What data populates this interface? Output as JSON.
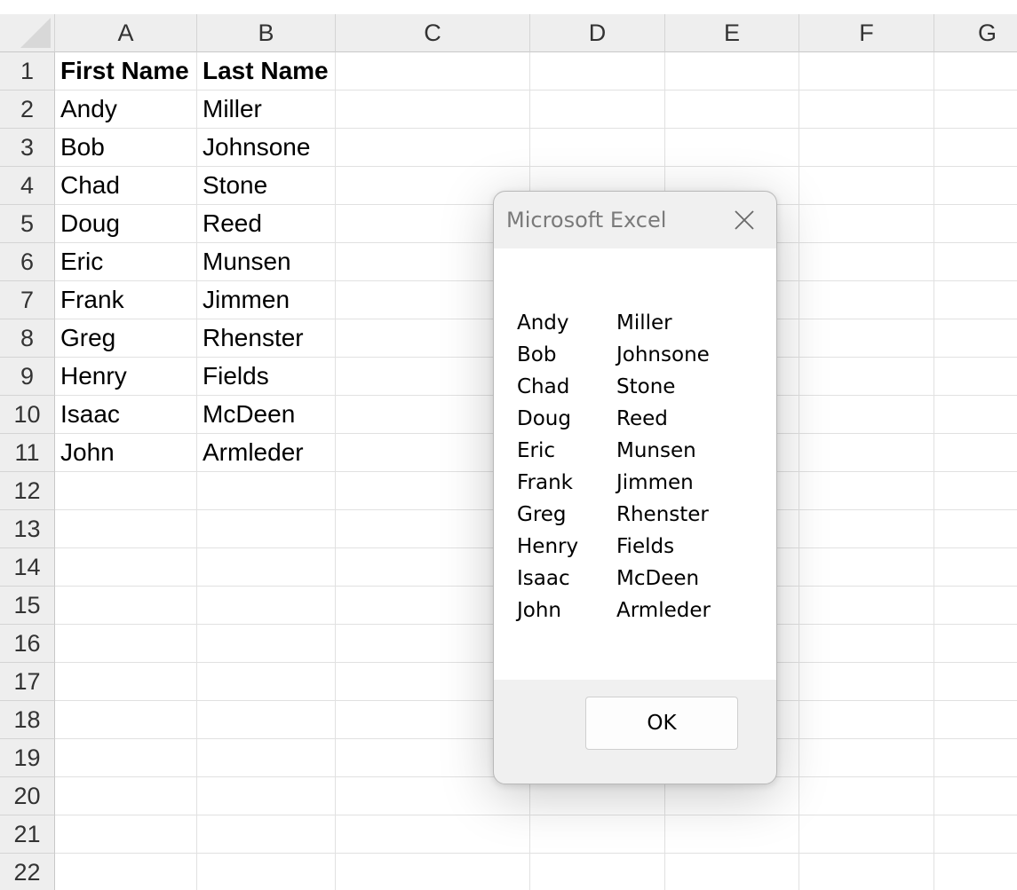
{
  "sheet": {
    "columns": [
      "A",
      "B",
      "C",
      "D",
      "E",
      "F",
      "G"
    ],
    "rows": [
      "1",
      "2",
      "3",
      "4",
      "5",
      "6",
      "7",
      "8",
      "9",
      "10",
      "11",
      "12",
      "13",
      "14",
      "15",
      "16",
      "17",
      "18",
      "19",
      "20",
      "21",
      "22"
    ],
    "cells": {
      "header": [
        "First Name",
        "Last Name"
      ],
      "data": [
        [
          "Andy",
          "Miller"
        ],
        [
          "Bob",
          "Johnsone"
        ],
        [
          "Chad",
          "Stone"
        ],
        [
          "Doug",
          "Reed"
        ],
        [
          "Eric",
          "Munsen"
        ],
        [
          "Frank",
          "Jimmen"
        ],
        [
          "Greg",
          "Rhenster"
        ],
        [
          "Henry",
          "Fields"
        ],
        [
          "Isaac",
          "McDeen"
        ],
        [
          "John",
          "Armleder"
        ]
      ]
    }
  },
  "dialog": {
    "title": "Microsoft Excel",
    "close_icon": "close-icon",
    "message": [
      [
        "Andy",
        "Miller"
      ],
      [
        "Bob",
        "Johnsone"
      ],
      [
        "Chad",
        "Stone"
      ],
      [
        "Doug",
        "Reed"
      ],
      [
        "Eric",
        "Munsen"
      ],
      [
        "Frank",
        "Jimmen"
      ],
      [
        "Greg",
        "Rhenster"
      ],
      [
        "Henry",
        "Fields"
      ],
      [
        "Isaac",
        "McDeen"
      ],
      [
        "John",
        "Armleder"
      ]
    ],
    "ok_label": "OK"
  }
}
